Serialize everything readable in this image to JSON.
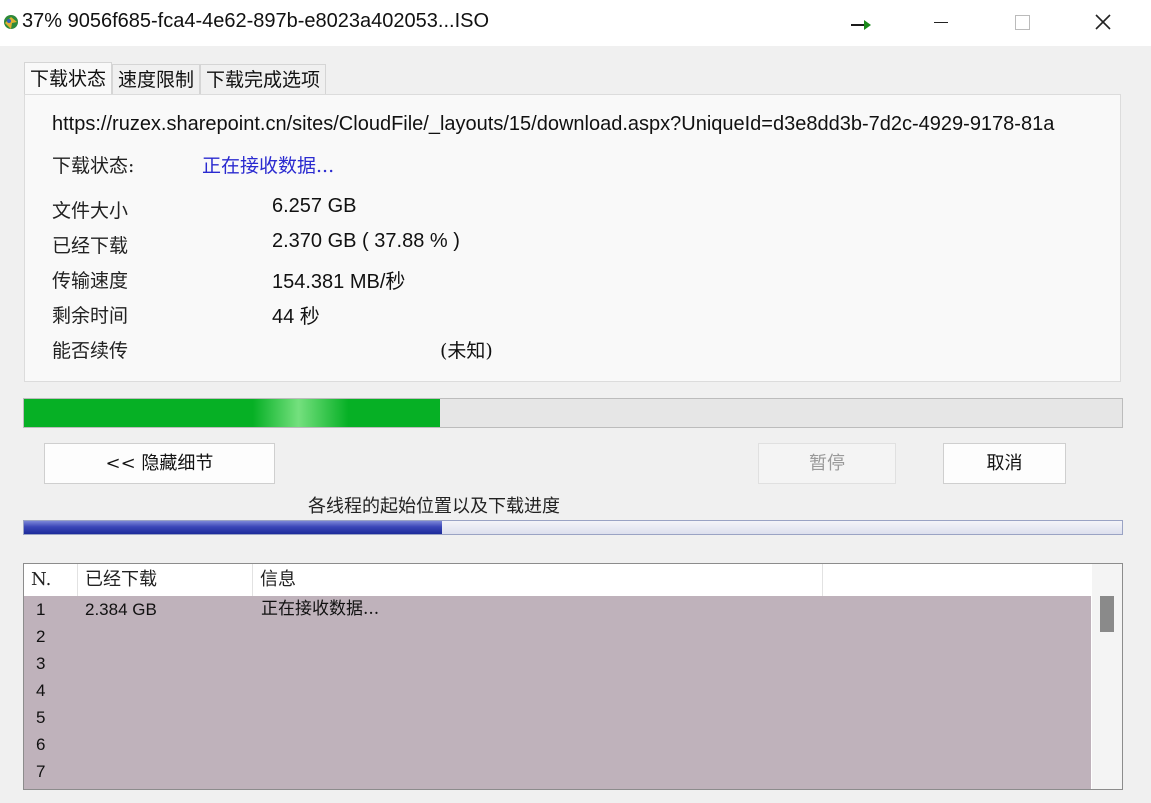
{
  "window": {
    "title": "37% 9056f685-fca4-4e62-897b-e8023a402053...ISO"
  },
  "tabs": [
    {
      "label": "下载状态",
      "active": true
    },
    {
      "label": "速度限制",
      "active": false
    },
    {
      "label": "下载完成选项",
      "active": false
    }
  ],
  "details": {
    "url": "https://ruzex.sharepoint.cn/sites/CloudFile/_layouts/15/download.aspx?UniqueId=d3e8dd3b-7d2c-4929-9178-81a",
    "status_label": "下载状态:",
    "status_value": "正在接收数据...",
    "file_size_label": "文件大小",
    "file_size_value": "6.257  GB",
    "downloaded_label": "已经下载",
    "downloaded_value": "2.370  GB  ( 37.88 % )",
    "speed_label": "传输速度",
    "speed_value": "154.381  MB/秒",
    "remaining_label": "剩余时间",
    "remaining_value": "44 秒",
    "resume_label": "能否续传",
    "resume_value": "(未知)"
  },
  "progress": {
    "fraction": 0.3788,
    "thread_fraction": 0.381
  },
  "buttons": {
    "hide_details": "<< 隐藏细节",
    "pause": "暂停",
    "cancel": "取消"
  },
  "threads_label": "各线程的起始位置以及下载进度",
  "list": {
    "columns": [
      "N.",
      "已经下载",
      "信息",
      ""
    ],
    "rows": [
      {
        "n": "1",
        "downloaded": "2.384  GB",
        "info": "正在接收数据..."
      },
      {
        "n": "2",
        "downloaded": "",
        "info": ""
      },
      {
        "n": "3",
        "downloaded": "",
        "info": ""
      },
      {
        "n": "4",
        "downloaded": "",
        "info": ""
      },
      {
        "n": "5",
        "downloaded": "",
        "info": ""
      },
      {
        "n": "6",
        "downloaded": "",
        "info": ""
      },
      {
        "n": "7",
        "downloaded": "",
        "info": ""
      }
    ]
  },
  "colors": {
    "progress_green": "#06b025",
    "status_blue": "#2a2ad0",
    "list_row_bg": "#bfb2bb",
    "thread_progress_blue": "#1c2a9a"
  },
  "icons": [
    "app-icon",
    "move-arrow-icon",
    "minimize-icon",
    "maximize-icon",
    "close-icon"
  ]
}
